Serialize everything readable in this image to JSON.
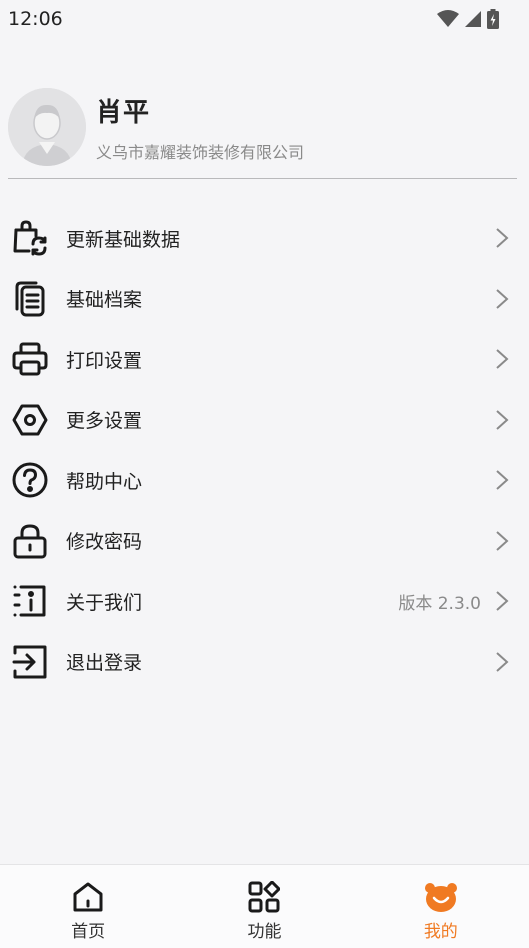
{
  "status_bar": {
    "time": "12:06"
  },
  "profile": {
    "name": "肖平",
    "company": "义乌市嘉耀装饰装修有限公司"
  },
  "menu": [
    {
      "label": "更新基础数据",
      "icon": "refresh-bag-icon"
    },
    {
      "label": "基础档案",
      "icon": "documents-icon"
    },
    {
      "label": "打印设置",
      "icon": "printer-icon"
    },
    {
      "label": "更多设置",
      "icon": "hexagon-settings-icon"
    },
    {
      "label": "帮助中心",
      "icon": "help-icon"
    },
    {
      "label": "修改密码",
      "icon": "lock-icon"
    },
    {
      "label": "关于我们",
      "icon": "info-icon",
      "value": "版本 2.3.0"
    },
    {
      "label": "退出登录",
      "icon": "logout-icon"
    }
  ],
  "tabbar": [
    {
      "label": "首页",
      "icon": "home-icon"
    },
    {
      "label": "功能",
      "icon": "grid-icon"
    },
    {
      "label": "我的",
      "icon": "bear-icon",
      "active": true
    }
  ],
  "colors": {
    "accent": "#f07a22",
    "background": "#f5f5f7",
    "text": "#222222",
    "muted": "#8a8a8a"
  }
}
